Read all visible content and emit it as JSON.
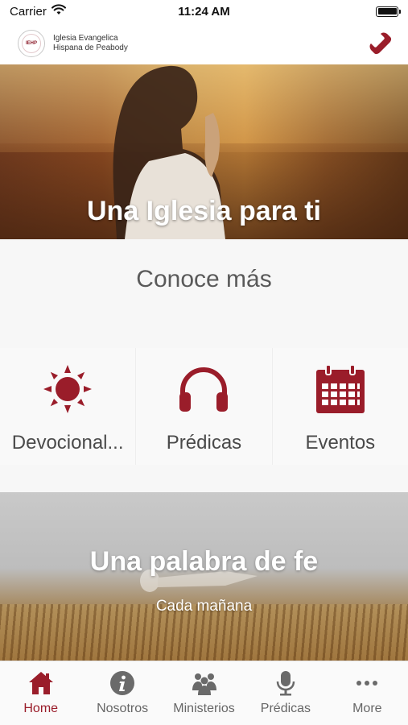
{
  "status_bar": {
    "carrier": "Carrier",
    "time": "11:24 AM"
  },
  "header": {
    "brand_line1": "Iglesia Evangelica",
    "brand_line2": "Hispana de Peabody",
    "logo_text": "IEHP",
    "phone_icon": "phone-icon"
  },
  "hero": {
    "title": "Una Iglesia para ti"
  },
  "conoce": {
    "title": "Conoce más",
    "cards": [
      {
        "label": "Devocional...",
        "icon": "sun-icon"
      },
      {
        "label": "Prédicas",
        "icon": "headphones-icon"
      },
      {
        "label": "Eventos",
        "icon": "calendar-icon"
      }
    ]
  },
  "promo": {
    "title": "Una palabra de fe",
    "subtitle": "Cada mañana"
  },
  "tabs": [
    {
      "label": "Home",
      "icon": "home-icon",
      "active": true
    },
    {
      "label": "Nosotros",
      "icon": "info-icon",
      "active": false
    },
    {
      "label": "Ministerios",
      "icon": "people-icon",
      "active": false
    },
    {
      "label": "Prédicas",
      "icon": "microphone-icon",
      "active": false
    },
    {
      "label": "More",
      "icon": "more-icon",
      "active": false
    }
  ],
  "colors": {
    "accent": "#9a1d2a",
    "tab_inactive": "#666666",
    "text_gray": "#5a5a5a"
  }
}
